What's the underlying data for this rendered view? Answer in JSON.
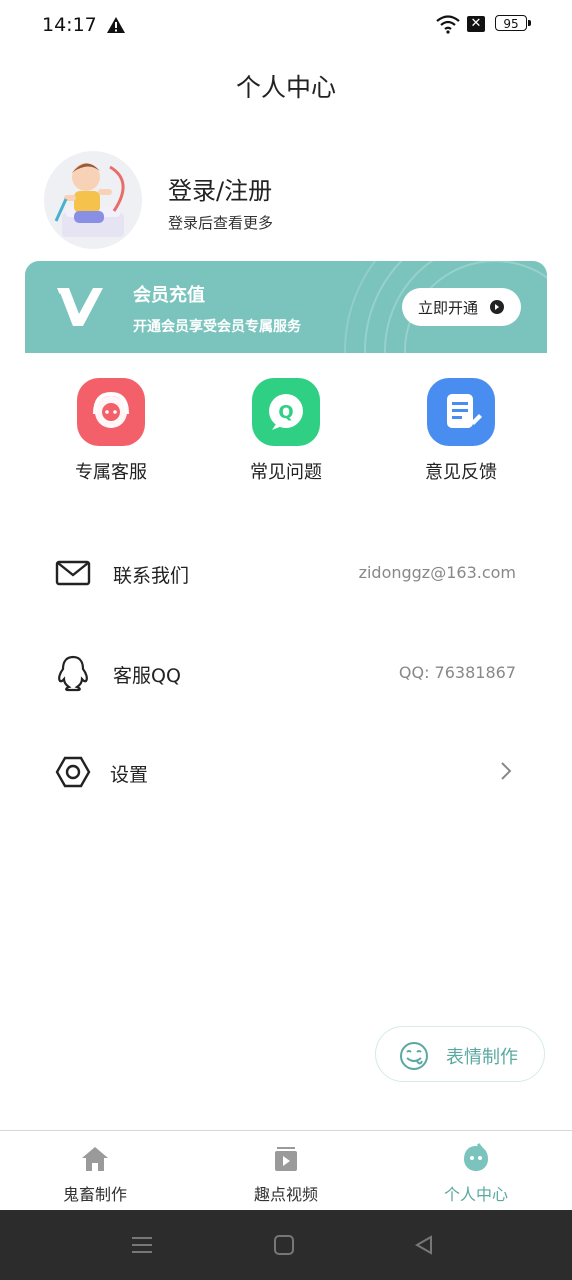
{
  "status": {
    "time": "14:17",
    "battery": "95"
  },
  "page_title": "个人中心",
  "profile": {
    "title": "登录/注册",
    "subtitle": "登录后查看更多"
  },
  "member_banner": {
    "title": "会员充值",
    "subtitle": "开通会员享受会员专属服务",
    "button_label": "立即开通"
  },
  "quick_actions": [
    {
      "label": "专属客服",
      "icon": "headset-icon",
      "color": "#f4606a"
    },
    {
      "label": "常见问题",
      "icon": "question-bubble-icon",
      "color": "#2fcf84"
    },
    {
      "label": "意见反馈",
      "icon": "feedback-note-icon",
      "color": "#4a8df0"
    }
  ],
  "list": [
    {
      "label": "联系我们",
      "value": "zidonggz@163.com",
      "icon": "mail-icon"
    },
    {
      "label": "客服QQ",
      "value": "QQ: 76381867",
      "icon": "qq-penguin-icon"
    },
    {
      "label": "设置",
      "value": "",
      "icon": "settings-hexagon-icon"
    }
  ],
  "fab_label": "表情制作",
  "tabs": [
    {
      "label": "鬼畜制作",
      "icon": "home-icon",
      "active": false
    },
    {
      "label": "趣点视频",
      "icon": "video-icon",
      "active": false
    },
    {
      "label": "个人中心",
      "icon": "profile-face-icon",
      "active": true
    }
  ],
  "colors": {
    "accent": "#5aa9a1",
    "banner": "#7ac4bd"
  }
}
